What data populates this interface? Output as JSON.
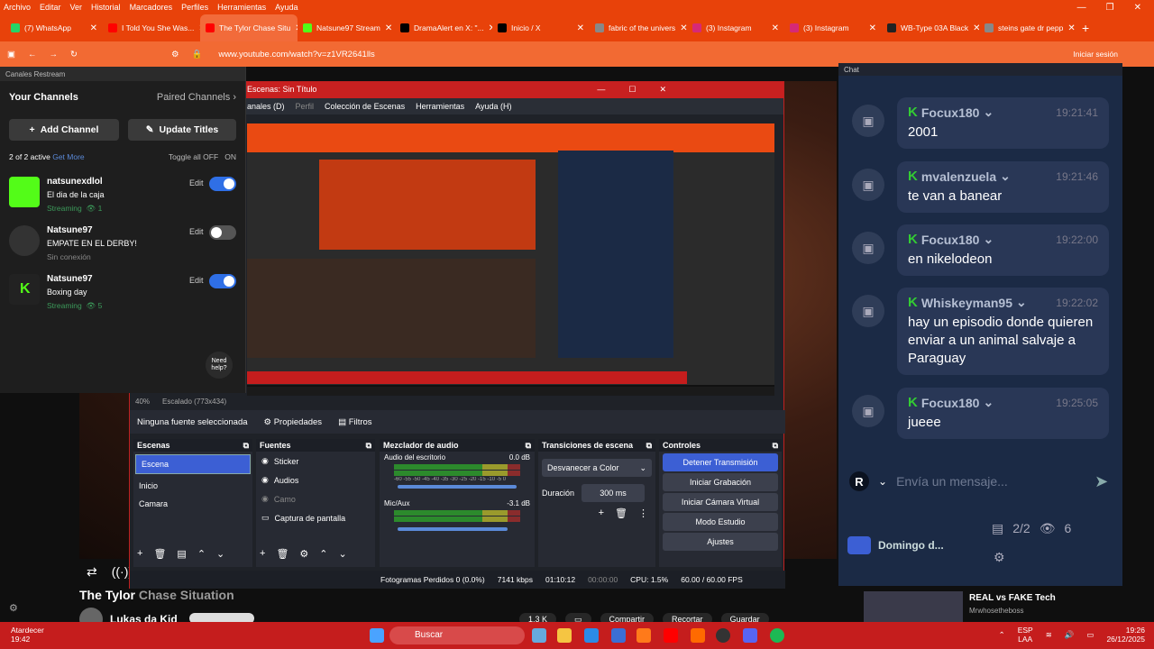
{
  "browser": {
    "menu": [
      "Archivo",
      "Editar",
      "Ver",
      "Historial",
      "Marcadores",
      "Perfiles",
      "Herramientas",
      "Ayuda"
    ],
    "tabs": [
      {
        "label": "(7) WhatsApp",
        "color": "#25d366"
      },
      {
        "label": "I Told You She Was...",
        "color": "#ff0000"
      },
      {
        "label": "The Tylor Chase Situ",
        "color": "#ff0000",
        "active": true
      },
      {
        "label": "Natsune97 Stream",
        "color": "#53fc18"
      },
      {
        "label": "DramaAlert en X: \"...",
        "color": "#000000"
      },
      {
        "label": "Inicio / X",
        "color": "#000000"
      },
      {
        "label": "fabric of the univers",
        "color": "#888888"
      },
      {
        "label": "(3) Instagram",
        "color": "#d62976"
      },
      {
        "label": "(3) Instagram",
        "color": "#d62976"
      },
      {
        "label": "WB-Type 03A Black",
        "color": "#222222"
      },
      {
        "label": "steins gate dr pepp",
        "color": "#888888"
      }
    ],
    "url": "www.youtube.com/watch?v=z1VR2641lls",
    "signin": "Iniciar sesión"
  },
  "restream": {
    "header": "Canales Restream",
    "your_channels": "Your Channels",
    "paired": "Paired Channels",
    "add_channel": "Add Channel",
    "update_titles": "Update Titles",
    "active_count": "2 of 2 active",
    "get_more": "Get More",
    "toggle_all": "Toggle all OFF",
    "on": "ON",
    "channels": [
      {
        "name": "natsunexdlol",
        "title": "El dia de la caja",
        "status": "Streaming",
        "viewers": "1",
        "on": true,
        "edit": "Edit"
      },
      {
        "name": "Natsune97",
        "title": "EMPATE EN EL DERBY!",
        "status": "Sin conexión",
        "viewers": "",
        "on": false,
        "edit": "Edit"
      },
      {
        "name": "Natsune97",
        "title": "Boxing day",
        "status": "Streaming",
        "viewers": "5",
        "on": true,
        "edit": "Edit"
      }
    ],
    "help": "Need help?"
  },
  "obs": {
    "title": "Escenas: Sin Título",
    "menu": [
      "anales (D)",
      "Perfil",
      "Colección de Escenas",
      "Herramientas",
      "Ayuda (H)"
    ],
    "zoom": "40%",
    "scaled": "Escalado (773x434)",
    "no_source": "Ninguna fuente seleccionada",
    "properties": "Propiedades",
    "filters": "Filtros",
    "docks": {
      "scenes": {
        "title": "Escenas",
        "items": [
          "Escena",
          "Inicio",
          "Camara"
        ]
      },
      "sources": {
        "title": "Fuentes",
        "items": [
          "Sticker",
          "Audios",
          "Camo",
          "Captura de pantalla"
        ]
      },
      "mixer": {
        "title": "Mezclador de audio",
        "ch1": "Audio del escritorio",
        "ch1db": "0.0 dB",
        "ch2": "Mic/Aux",
        "ch2db": "-3.1 dB",
        "scale": "-60 -55 -50 -45 -40 -35 -30 -25 -20 -15 -10 -5 0"
      },
      "transitions": {
        "title": "Transiciones de escena",
        "fade": "Desvanecer a Color",
        "duration_label": "Duración",
        "duration": "300 ms"
      },
      "controls": {
        "title": "Controles",
        "stop": "Detener Transmisión",
        "record": "Iniciar Grabación",
        "vcam": "Iniciar Cámara Virtual",
        "studio": "Modo Estudio",
        "settings": "Ajustes"
      }
    },
    "status": {
      "dropped": "Fotogramas Perdidos 0 (0.0%)",
      "kbps": "7141 kbps",
      "live": "01:10:12",
      "rec": "00:00:00",
      "cpu": "CPU: 1.5%",
      "fps": "60.00 / 60.00 FPS"
    }
  },
  "youtube": {
    "title_a": "The Tylor",
    "title_b": "Chase Situation",
    "channel": "Lukas da Kid",
    "actions": [
      "1.3 K",
      "",
      "Compartir",
      "Recortar",
      "Guardar"
    ]
  },
  "chat": {
    "header": "Chat",
    "messages": [
      {
        "user": "Focux180",
        "time": "19:21:41",
        "text": "2001"
      },
      {
        "user": "mvalenzuela",
        "time": "19:21:46",
        "text": "te van a banear"
      },
      {
        "user": "Focux180",
        "time": "19:22:00",
        "text": "en nikelodeon"
      },
      {
        "user": "Whiskeyman95",
        "time": "19:22:02",
        "text": "hay un episodio donde quieren enviar a un animal salvaje a Paraguay"
      },
      {
        "user": "Focux180",
        "time": "19:25:05",
        "text": "jueee"
      }
    ],
    "placeholder": "Envía un mensaje...",
    "platforms": "2/2",
    "viewers": "6",
    "user": "Domingo d..."
  },
  "sidebar_video": {
    "title": "REAL vs FAKE Tech",
    "channel": "Mrwhosetheboss"
  },
  "taskbar": {
    "weather": "Atardecer",
    "weather_time": "19:42",
    "search": "Buscar",
    "lang": "ESP",
    "lang2": "LAA",
    "time": "19:26",
    "date": "26/12/2025"
  },
  "colors": {
    "accent": "#e8420a",
    "obs_blue": "#3c5fd4",
    "kick_green": "#53fc18",
    "toggle_on": "#2f6fe6"
  }
}
